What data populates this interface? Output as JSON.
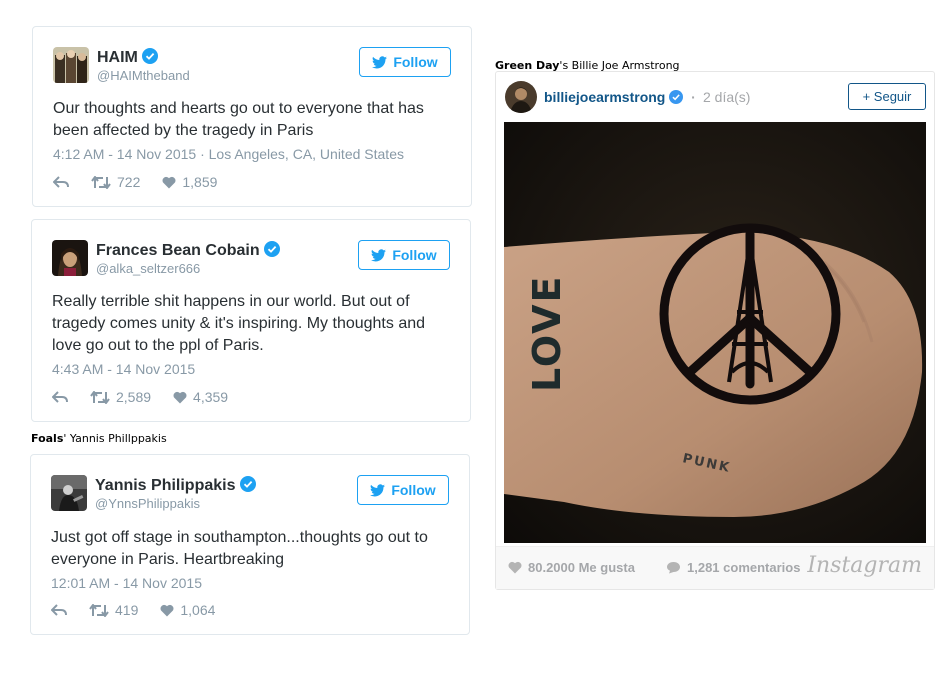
{
  "colors": {
    "twitter_blue": "#1da1f2",
    "instagram_blue": "#125688",
    "muted": "#8899a6"
  },
  "tweets": [
    {
      "name": "HAIM",
      "handle": "@HAIMtheband",
      "follow_label": "Follow",
      "text": "Our thoughts and hearts go out to everyone that has been affected by the tragedy in Paris",
      "meta": "4:12 AM - 14 Nov 2015 · Los Angeles, CA, United States",
      "retweets": "722",
      "likes": "1,859"
    },
    {
      "name": "Frances Bean Cobain",
      "handle": "@alka_seltzer666",
      "follow_label": "Follow",
      "text": "Really terrible shit happens in our world. But out of tragedy comes unity & it's inspiring. My thoughts and love go out to the ppl of Paris.",
      "meta": "4:43 AM - 14 Nov 2015",
      "retweets": "2,589",
      "likes": "4,359"
    },
    {
      "name": "Yannis Philippakis",
      "handle": "@YnnsPhilippakis",
      "follow_label": "Follow",
      "text": "Just got off stage in southampton...thoughts go out to everyone in Paris. Heartbreaking",
      "meta": "12:01 AM - 14 Nov 2015",
      "retweets": "419",
      "likes": "1,064"
    }
  ],
  "captions": {
    "foals_band": "Foals",
    "foals_rest": "' Yannis Phillppakis",
    "greenday_band": "Green Day",
    "greenday_rest": "'s Billie Joe Armstrong"
  },
  "instagram": {
    "username": "billiejoearmstrong",
    "time": "2 día(s)",
    "follow_label": "+ Seguir",
    "likes": "80.2000 Me gusta",
    "comments": "1,281 comentarios",
    "logo": "Instagram",
    "tattoo_love": "LOVE",
    "tattoo_punk": "PUNK"
  }
}
